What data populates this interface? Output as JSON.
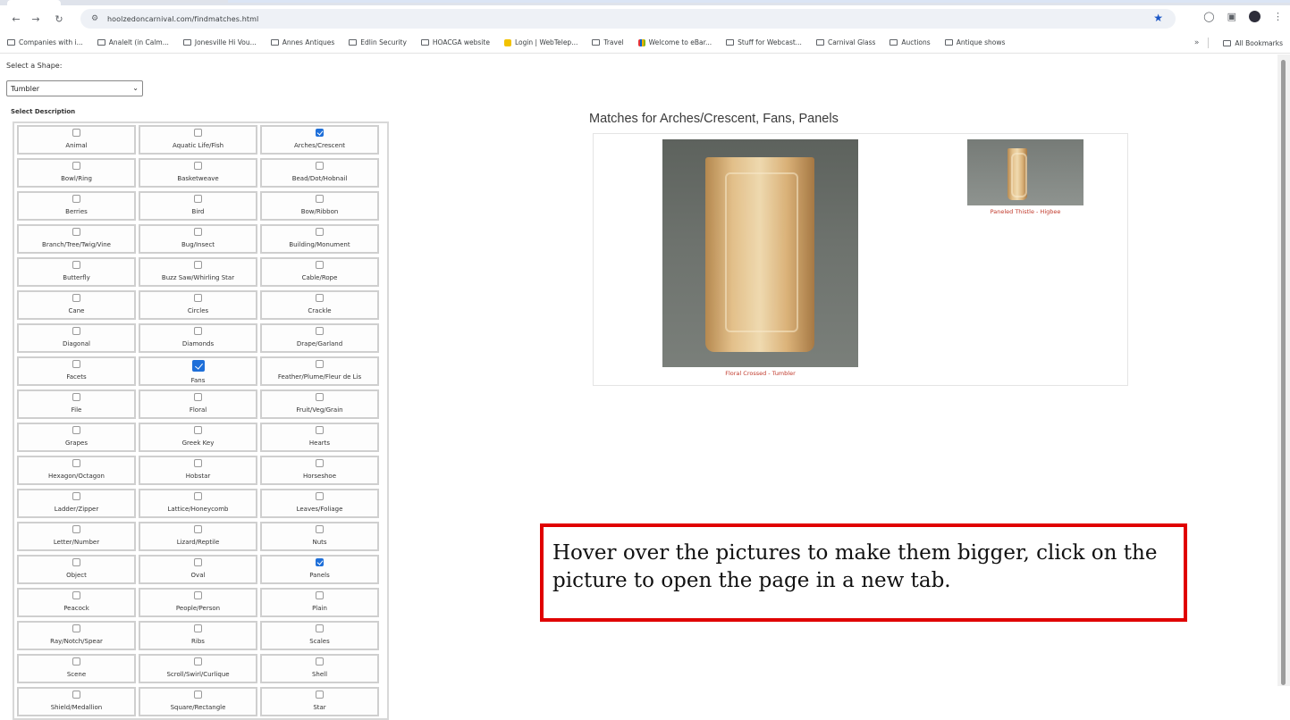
{
  "browser": {
    "url": "hoolzedoncarnival.com/findmatches.html",
    "bookmarks": [
      {
        "label": "Companies with i...",
        "icon": "folder"
      },
      {
        "label": "Analelt (in Calm...",
        "icon": "folder"
      },
      {
        "label": "Jonesville Hi Vou...",
        "icon": "folder"
      },
      {
        "label": "Annes Antiques",
        "icon": "folder"
      },
      {
        "label": "Edlin Security",
        "icon": "folder"
      },
      {
        "label": "HOACGA website",
        "icon": "folder"
      },
      {
        "label": "Login | WebTelep...",
        "icon": "yellow"
      },
      {
        "label": "Travel",
        "icon": "folder"
      },
      {
        "label": "Welcome to eBar...",
        "icon": "multi"
      },
      {
        "label": "Stuff for Webcast...",
        "icon": "folder"
      },
      {
        "label": "Carnival Glass",
        "icon": "folder"
      },
      {
        "label": "Auctions",
        "icon": "folder"
      },
      {
        "label": "Antique shows",
        "icon": "folder"
      }
    ],
    "all_bookmarks": "All Bookmarks"
  },
  "filters": {
    "shape_label": "Select a Shape:",
    "shape_value": "Tumbler",
    "description_label": "Select Description"
  },
  "descriptions": [
    {
      "label": "Animal",
      "checked": false
    },
    {
      "label": "Aquatic Life/Fish",
      "checked": false
    },
    {
      "label": "Arches/Crescent",
      "checked": true
    },
    {
      "label": "Bowl/Ring",
      "checked": false
    },
    {
      "label": "Basketweave",
      "checked": false
    },
    {
      "label": "Bead/Dot/Hobnail",
      "checked": false
    },
    {
      "label": "Berries",
      "checked": false
    },
    {
      "label": "Bird",
      "checked": false
    },
    {
      "label": "Bow/Ribbon",
      "checked": false
    },
    {
      "label": "Branch/Tree/Twig/Vine",
      "checked": false
    },
    {
      "label": "Bug/Insect",
      "checked": false
    },
    {
      "label": "Building/Monument",
      "checked": false
    },
    {
      "label": "Butterfly",
      "checked": false
    },
    {
      "label": "Buzz Saw/Whirling Star",
      "checked": false
    },
    {
      "label": "Cable/Rope",
      "checked": false
    },
    {
      "label": "Cane",
      "checked": false
    },
    {
      "label": "Circles",
      "checked": false
    },
    {
      "label": "Crackle",
      "checked": false
    },
    {
      "label": "Diagonal",
      "checked": false
    },
    {
      "label": "Diamonds",
      "checked": false
    },
    {
      "label": "Drape/Garland",
      "checked": false
    },
    {
      "label": "Facets",
      "checked": false
    },
    {
      "label": "Fans",
      "checked": true,
      "big": true
    },
    {
      "label": "Feather/Plume/Fleur de Lis",
      "checked": false
    },
    {
      "label": "File",
      "checked": false
    },
    {
      "label": "Floral",
      "checked": false
    },
    {
      "label": "Fruit/Veg/Grain",
      "checked": false
    },
    {
      "label": "Grapes",
      "checked": false
    },
    {
      "label": "Greek Key",
      "checked": false
    },
    {
      "label": "Hearts",
      "checked": false
    },
    {
      "label": "Hexagon/Octagon",
      "checked": false
    },
    {
      "label": "Hobstar",
      "checked": false
    },
    {
      "label": "Horseshoe",
      "checked": false
    },
    {
      "label": "Ladder/Zipper",
      "checked": false
    },
    {
      "label": "Lattice/Honeycomb",
      "checked": false
    },
    {
      "label": "Leaves/Foliage",
      "checked": false
    },
    {
      "label": "Letter/Number",
      "checked": false
    },
    {
      "label": "Lizard/Reptile",
      "checked": false
    },
    {
      "label": "Nuts",
      "checked": false
    },
    {
      "label": "Object",
      "checked": false
    },
    {
      "label": "Oval",
      "checked": false
    },
    {
      "label": "Panels",
      "checked": true
    },
    {
      "label": "Peacock",
      "checked": false
    },
    {
      "label": "People/Person",
      "checked": false
    },
    {
      "label": "Plain",
      "checked": false
    },
    {
      "label": "Ray/Notch/Spear",
      "checked": false
    },
    {
      "label": "Ribs",
      "checked": false
    },
    {
      "label": "Scales",
      "checked": false
    },
    {
      "label": "Scene",
      "checked": false
    },
    {
      "label": "Scroll/Swirl/Curlique",
      "checked": false
    },
    {
      "label": "Shell",
      "checked": false
    },
    {
      "label": "Shield/Medallion",
      "checked": false
    },
    {
      "label": "Square/Rectangle",
      "checked": false
    },
    {
      "label": "Star",
      "checked": false
    }
  ],
  "results": {
    "title": "Matches for Arches/Crescent, Fans, Panels",
    "items": [
      {
        "caption": "Floral Crossed - Tumbler"
      },
      {
        "caption": "Paneled Thistle - Higbee"
      }
    ]
  },
  "note": "Hover over the pictures to make them bigger, click on the picture to open the page in a new tab."
}
